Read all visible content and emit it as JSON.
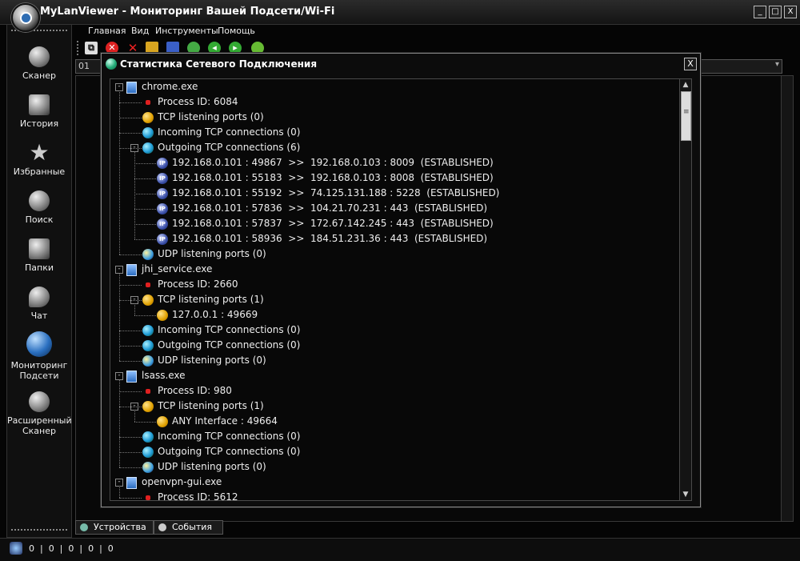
{
  "window": {
    "title": "MyLanViewer - Мониторинг Вашей Подсети/Wi-Fi",
    "btn_min": "_",
    "btn_max": "□",
    "btn_close": "X"
  },
  "menu": [
    "Главная",
    "Вид",
    "Инструменты",
    "Помощь"
  ],
  "sidebar": [
    {
      "label": "Сканер",
      "icon": "radar-icon"
    },
    {
      "label": "История",
      "icon": "history-icon"
    },
    {
      "label": "Избранные",
      "icon": "star-icon"
    },
    {
      "label": "Поиск",
      "icon": "search-icon"
    },
    {
      "label": "Папки",
      "icon": "folder-icon"
    },
    {
      "label": "Чат",
      "icon": "chat-icon"
    },
    {
      "label": "Мониторинг Подсети",
      "icon": "globe-monitor-icon"
    },
    {
      "label": "Расширенный Сканер",
      "icon": "advanced-scanner-icon"
    }
  ],
  "toolbar_tab": "01",
  "bottom_tabs": [
    "Устройства",
    "События"
  ],
  "status": "0  |  0  |  0  |  0  |  0",
  "dialog": {
    "title": "Статистика Сетевого Подключения",
    "close": "X"
  },
  "tree": [
    {
      "level": 0,
      "icon": "file",
      "text": "chrome.exe",
      "exp": "-"
    },
    {
      "level": 1,
      "icon": "pid",
      "text": "Process ID: 6084"
    },
    {
      "level": 1,
      "icon": "port",
      "text": "TCP listening ports (0)"
    },
    {
      "level": 1,
      "icon": "conn",
      "text": "Incoming TCP connections (0)"
    },
    {
      "level": 1,
      "icon": "conn",
      "text": "Outgoing TCP connections (6)",
      "exp": "-"
    },
    {
      "level": 2,
      "icon": "ip",
      "text": "192.168.0.101 : 49867  >>  192.168.0.103 : 8009  (ESTABLISHED)"
    },
    {
      "level": 2,
      "icon": "ip",
      "text": "192.168.0.101 : 55183  >>  192.168.0.103 : 8008  (ESTABLISHED)"
    },
    {
      "level": 2,
      "icon": "ip",
      "text": "192.168.0.101 : 55192  >>  74.125.131.188 : 5228  (ESTABLISHED)"
    },
    {
      "level": 2,
      "icon": "ip",
      "text": "192.168.0.101 : 57836  >>  104.21.70.231 : 443  (ESTABLISHED)"
    },
    {
      "level": 2,
      "icon": "ip",
      "text": "192.168.0.101 : 57837  >>  172.67.142.245 : 443  (ESTABLISHED)"
    },
    {
      "level": 2,
      "icon": "ip",
      "text": "192.168.0.101 : 58936  >>  184.51.231.36 : 443  (ESTABLISHED)"
    },
    {
      "level": 1,
      "icon": "udp",
      "text": "UDP listening ports (0)"
    },
    {
      "level": 0,
      "icon": "file",
      "text": "jhi_service.exe",
      "exp": "-"
    },
    {
      "level": 1,
      "icon": "pid",
      "text": "Process ID: 2660"
    },
    {
      "level": 1,
      "icon": "port",
      "text": "TCP listening ports (1)",
      "exp": "-"
    },
    {
      "level": 2,
      "icon": "port",
      "text": "127.0.0.1 : 49669"
    },
    {
      "level": 1,
      "icon": "conn",
      "text": "Incoming TCP connections (0)"
    },
    {
      "level": 1,
      "icon": "conn",
      "text": "Outgoing TCP connections (0)"
    },
    {
      "level": 1,
      "icon": "udp",
      "text": "UDP listening ports (0)"
    },
    {
      "level": 0,
      "icon": "file",
      "text": "lsass.exe",
      "exp": "-"
    },
    {
      "level": 1,
      "icon": "pid",
      "text": "Process ID: 980"
    },
    {
      "level": 1,
      "icon": "port",
      "text": "TCP listening ports (1)",
      "exp": "-"
    },
    {
      "level": 2,
      "icon": "port",
      "text": "ANY Interface : 49664"
    },
    {
      "level": 1,
      "icon": "conn",
      "text": "Incoming TCP connections (0)"
    },
    {
      "level": 1,
      "icon": "conn",
      "text": "Outgoing TCP connections (0)"
    },
    {
      "level": 1,
      "icon": "udp",
      "text": "UDP listening ports (0)"
    },
    {
      "level": 0,
      "icon": "file",
      "text": "openvpn-gui.exe",
      "exp": "-"
    },
    {
      "level": 1,
      "icon": "pid",
      "text": "Process ID: 5612"
    }
  ]
}
